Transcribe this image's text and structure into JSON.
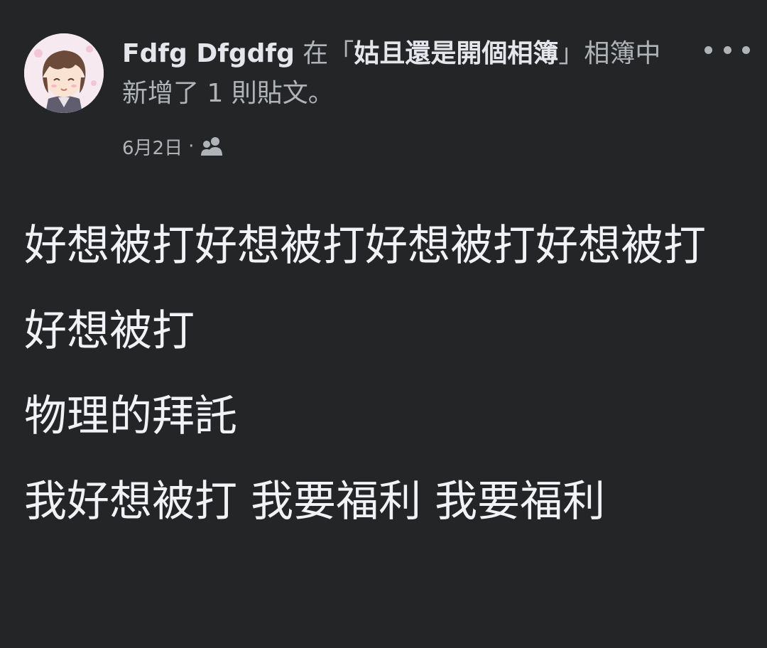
{
  "post": {
    "author_name": "Fdfg Dfgdfg",
    "action_prefix": "在",
    "quote_open": "「",
    "album_name": "姑且還是開個相簿",
    "quote_close": "」",
    "action_suffix": "相簿中新增了 1 則貼文。",
    "date": "6月2日",
    "separator": "·",
    "audience_icon": "friends-icon",
    "more_icon": "more-horizontal-icon",
    "body_lines": [
      "好想被打好想被打好想被打好想被打好想被打",
      "物理的拜託",
      "我好想被打 我要福利 我要福利"
    ]
  }
}
